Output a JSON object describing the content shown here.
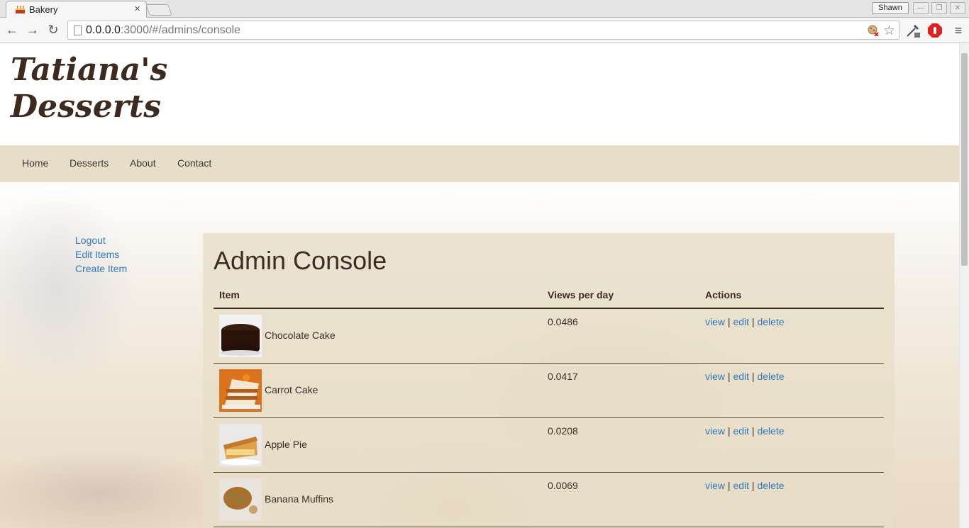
{
  "browser": {
    "tab_title": "Bakery",
    "tab_close": "×",
    "profile_name": "Shawn",
    "url_host": "0.0.0.0",
    "url_rest": ":3000/#/admins/console"
  },
  "site": {
    "logo_line1": "Tatiana's",
    "logo_line2": "Desserts"
  },
  "nav": {
    "items": [
      {
        "label": "Home"
      },
      {
        "label": "Desserts"
      },
      {
        "label": "About"
      },
      {
        "label": "Contact"
      }
    ]
  },
  "sidebar": {
    "links": [
      {
        "label": "Logout"
      },
      {
        "label": "Edit Items"
      },
      {
        "label": "Create Item"
      }
    ]
  },
  "console": {
    "title": "Admin Console",
    "columns": {
      "item": "Item",
      "views": "Views per day",
      "actions": "Actions"
    },
    "rows": [
      {
        "name": "Chocolate Cake",
        "views": "0.0486",
        "thumb": "chocolate-cake"
      },
      {
        "name": "Carrot Cake",
        "views": "0.0417",
        "thumb": "carrot-cake"
      },
      {
        "name": "Apple Pie",
        "views": "0.0208",
        "thumb": "apple-pie"
      },
      {
        "name": "Banana Muffins",
        "views": "0.0069",
        "thumb": "banana-muffins"
      }
    ],
    "action_labels": {
      "view": "view",
      "edit": "edit",
      "delete": "delete",
      "sep": "|"
    }
  },
  "colors": {
    "accent_link": "#3379b7",
    "navbar_bg": "#e8ddc7",
    "logo": "#3d2b1f"
  }
}
